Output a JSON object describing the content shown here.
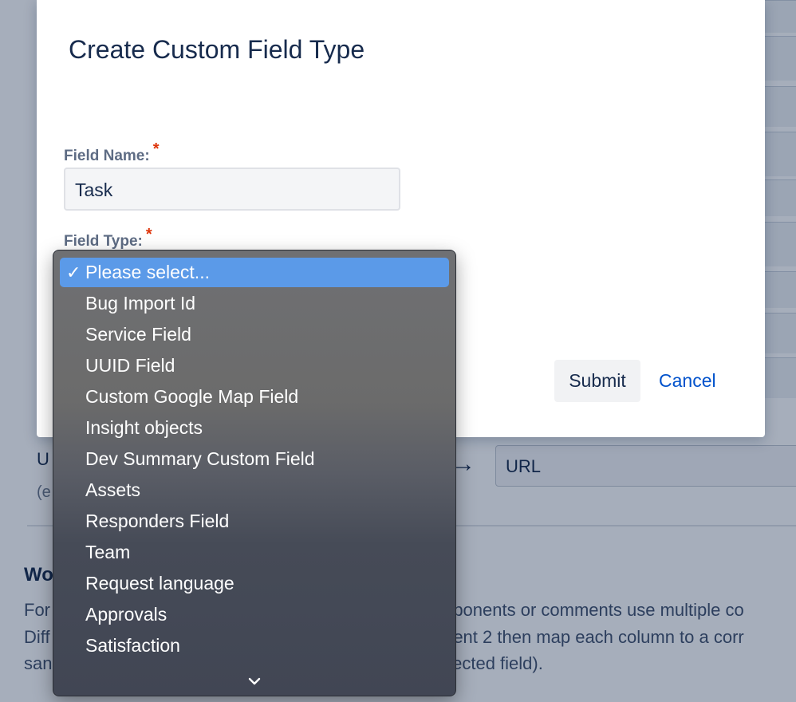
{
  "dialog": {
    "title": "Create Custom Field Type",
    "field_name_label": "Field Name:",
    "field_name_value": "Task",
    "field_type_label": "Field Type:",
    "required_marker": "*",
    "submit_label": "Submit",
    "cancel_label": "Cancel"
  },
  "dropdown": {
    "selected_index": 0,
    "check_mark": "✓",
    "options": [
      "Please select...",
      "Bug Import Id",
      "Service Field",
      "UUID Field",
      "Custom Google Map Field",
      "Insight objects",
      "Dev Summary Custom Field",
      "Assets",
      "Responders Field",
      "Team",
      "Request language",
      "Approvals",
      "Satisfaction"
    ],
    "more_indicator_icon": "chevron-down-icon"
  },
  "background": {
    "url_label_fragment": "U",
    "url_hint_fragment": "(e",
    "arrow": "→",
    "url_value": "URL",
    "heading_fragment": "Wo",
    "line1_left": "For",
    "line1_right": "mponents or comments use multiple co",
    "line2_left": "Diff",
    "line2_right": "ment 2 then map each column to a corr",
    "line3_left": "san",
    "line3_right": "elected field)."
  },
  "colors": {
    "accent": "#0052cc",
    "selected_highlight": "#5b9ae8",
    "required": "#de350b"
  }
}
